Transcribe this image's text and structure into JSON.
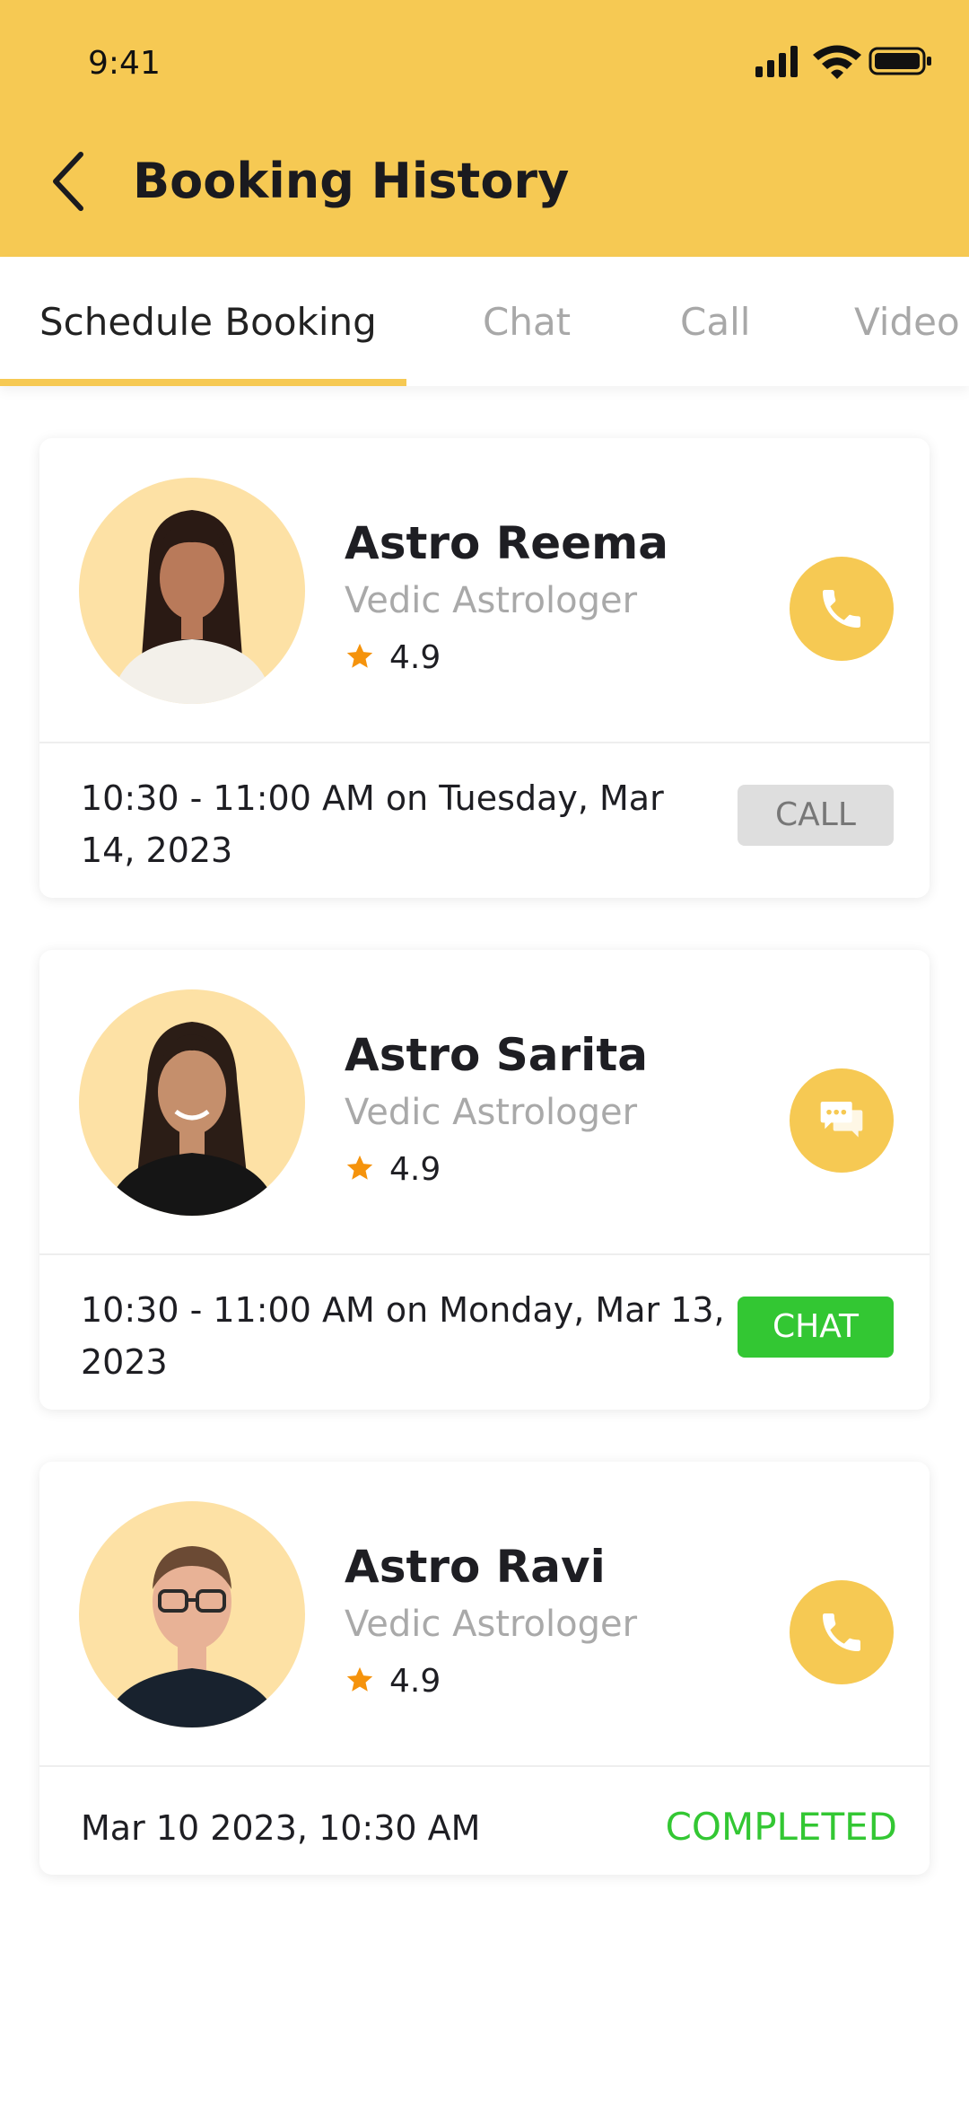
{
  "status_bar": {
    "time": "9:41"
  },
  "header": {
    "title": "Booking History"
  },
  "tabs": [
    {
      "label": "Schedule Booking",
      "active": true
    },
    {
      "label": "Chat",
      "active": false
    },
    {
      "label": "Call",
      "active": false
    },
    {
      "label": "Video",
      "active": false
    }
  ],
  "bookings": [
    {
      "name": "Astro Reema",
      "role": "Vedic Astrologer",
      "rating": "4.9",
      "action_icon": "phone-icon",
      "slot": "10:30 - 11:00 AM on Tuesday, Mar 14, 2023",
      "status": "CALL"
    },
    {
      "name": "Astro Sarita",
      "role": "Vedic Astrologer",
      "rating": "4.9",
      "action_icon": "chat-icon",
      "slot": "10:30 - 11:00 AM on Monday, Mar 13, 2023",
      "status": "CHAT"
    },
    {
      "name": "Astro Ravi",
      "role": "Vedic Astrologer",
      "rating": "4.9",
      "action_icon": "phone-icon",
      "slot": "Mar 10 2023, 10:30 AM",
      "status": "COMPLETED"
    }
  ],
  "colors": {
    "brand_yellow": "#f6c953",
    "avatar_bg": "#fde1a5",
    "star": "#f5930c",
    "success_green": "#33c733",
    "muted_badge": "#dedede"
  }
}
